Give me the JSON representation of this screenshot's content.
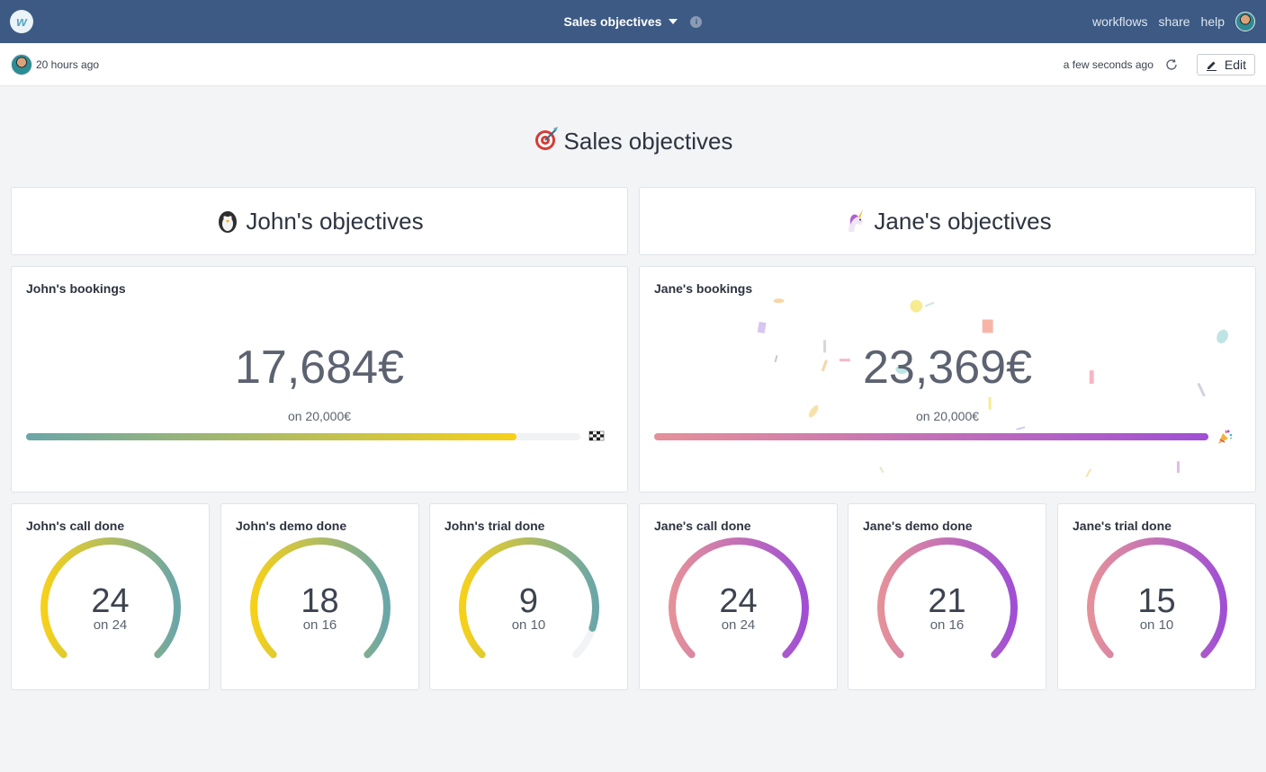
{
  "topbar": {
    "logo_letter": "w",
    "title": "Sales objectives",
    "info_symbol": "i",
    "nav": [
      "workflows",
      "share",
      "help"
    ]
  },
  "subbar": {
    "last_edited": "20 hours ago",
    "last_refreshed": "a few seconds ago",
    "edit_label": "Edit"
  },
  "page": {
    "heading": "Sales objectives",
    "heading_icon": "target-dart-icon"
  },
  "sections": [
    {
      "heading": "John's objectives",
      "icon": "penguin-icon"
    },
    {
      "heading": "Jane's objectives",
      "icon": "unicorn-icon"
    }
  ],
  "kpis": [
    {
      "label": "John's bookings",
      "value": "17,684€",
      "target": "on 20,000€",
      "progress": 0.884,
      "end_icon": "checkered-flag-icon",
      "gradient": [
        "#6aa6a8",
        "#f6d11a"
      ]
    },
    {
      "label": "Jane's bookings",
      "value": "23,369€",
      "target": "on 20,000€",
      "progress": 1.0,
      "end_icon": "party-popper-icon",
      "gradient": [
        "#e5919a",
        "#a04fd4"
      ]
    }
  ],
  "gauges": [
    {
      "label": "John's call done",
      "value": "24",
      "target": "on 24",
      "progress": 1.0,
      "scheme": "john"
    },
    {
      "label": "John's demo done",
      "value": "18",
      "target": "on 16",
      "progress": 1.0,
      "scheme": "john"
    },
    {
      "label": "John's trial done",
      "value": "9",
      "target": "on 10",
      "progress": 0.9,
      "scheme": "john"
    },
    {
      "label": "Jane's call done",
      "value": "24",
      "target": "on 24",
      "progress": 1.0,
      "scheme": "jane"
    },
    {
      "label": "Jane's demo done",
      "value": "21",
      "target": "on 16",
      "progress": 1.0,
      "scheme": "jane"
    },
    {
      "label": "Jane's trial done",
      "value": "15",
      "target": "on 10",
      "progress": 1.0,
      "scheme": "jane"
    }
  ],
  "colors": {
    "topbar": "#3c5a83",
    "john_start": "#f6d11a",
    "john_end": "#6aa6a8",
    "jane_start": "#e5919a",
    "jane_end": "#a04fd4"
  }
}
